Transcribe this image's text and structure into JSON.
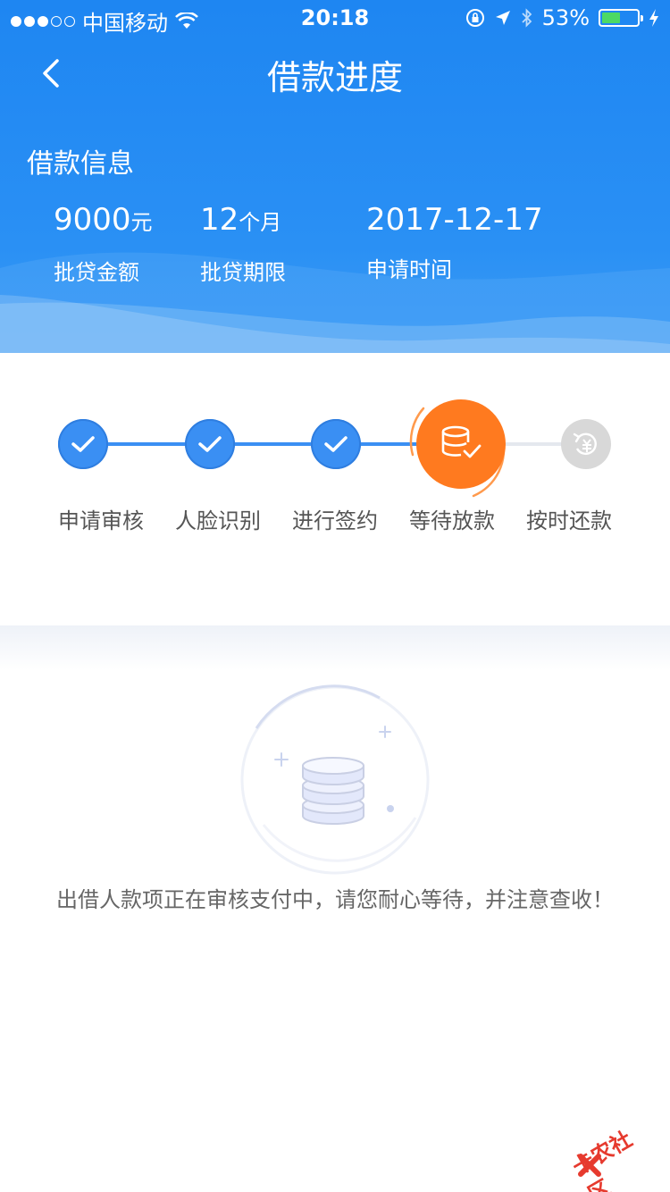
{
  "status_bar": {
    "carrier": "中国移动",
    "time": "20:18",
    "battery_percent": "53%",
    "battery_level": 0.53
  },
  "nav": {
    "title": "借款进度"
  },
  "loan_info": {
    "section_title": "借款信息",
    "items": [
      {
        "value": "9000",
        "unit": "元",
        "label": "批贷金额"
      },
      {
        "value": "12",
        "unit": "个月",
        "label": "批贷期限"
      },
      {
        "value": "2017-12-17",
        "unit": "",
        "label": "申请时间"
      }
    ]
  },
  "steps": [
    {
      "label": "申请审核",
      "state": "done",
      "icon": "check-icon"
    },
    {
      "label": "人脸识别",
      "state": "done",
      "icon": "check-icon"
    },
    {
      "label": "进行签约",
      "state": "done",
      "icon": "check-icon"
    },
    {
      "label": "等待放款",
      "state": "active",
      "icon": "coin-stack-check-icon"
    },
    {
      "label": "按时还款",
      "state": "pending",
      "icon": "repay-icon"
    }
  ],
  "message": "出借人款项正在审核支付中，请您耐心等待，并注意查收！",
  "watermark": "卡农社区",
  "colors": {
    "primary": "#1e86f2",
    "active": "#ff7a1f",
    "pending": "#d8d8d8",
    "battery": "#4cd964"
  }
}
